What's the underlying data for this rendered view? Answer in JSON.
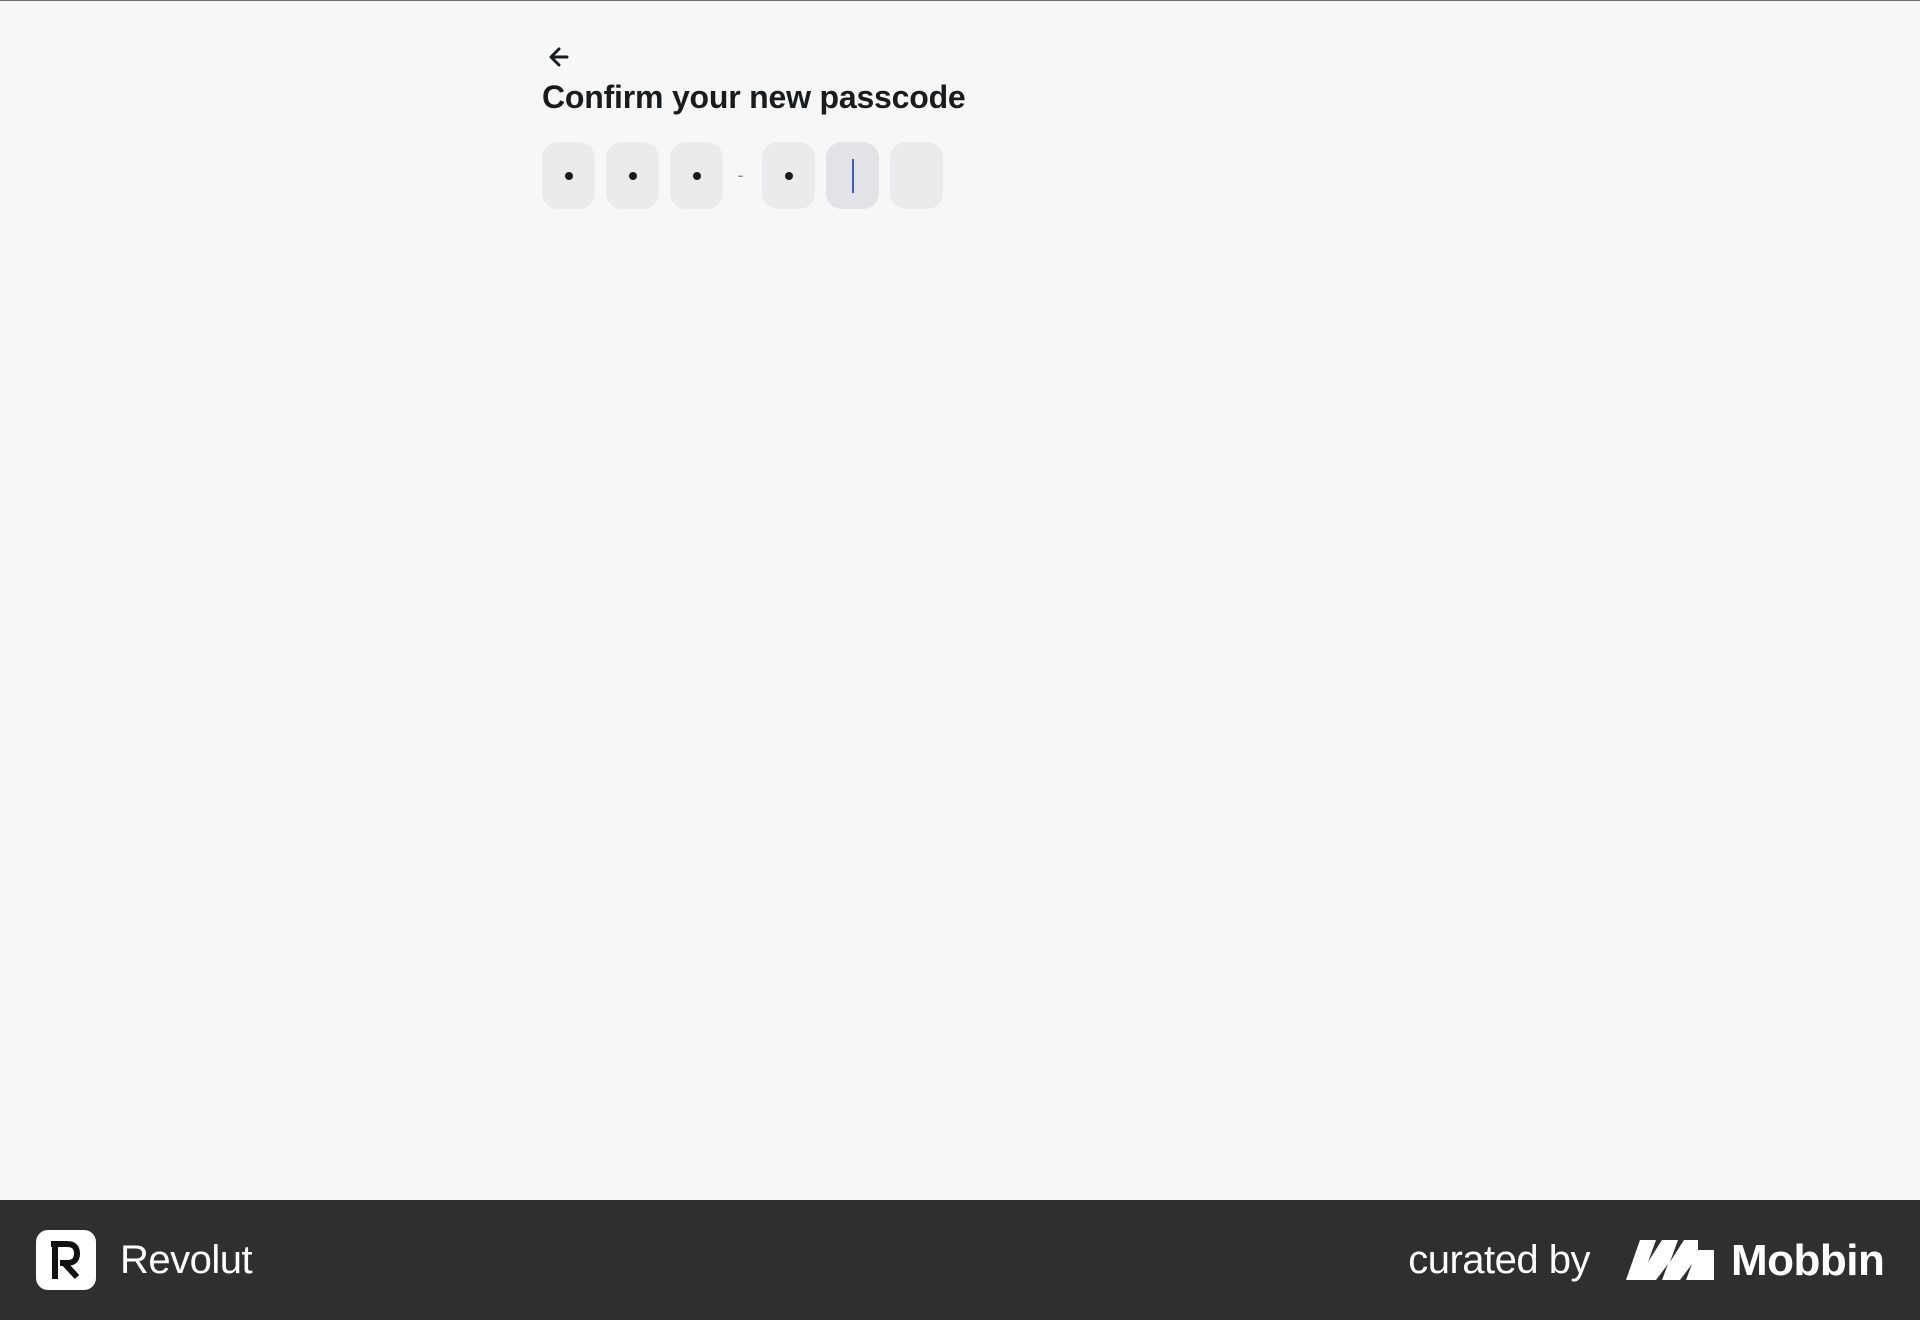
{
  "screen": {
    "title": "Confirm your new passcode",
    "back_icon": "back-arrow-icon"
  },
  "passcode": {
    "length": 6,
    "filled_count": 4,
    "active_index": 4,
    "separator": "-",
    "accent_color": "#3b5bdb",
    "slots": [
      {
        "state": "filled"
      },
      {
        "state": "filled"
      },
      {
        "state": "filled"
      },
      {
        "state": "filled"
      },
      {
        "state": "active"
      },
      {
        "state": "empty"
      }
    ]
  },
  "footer": {
    "brand_name": "Revolut",
    "brand_icon": "revolut-logo-icon",
    "curated_by": "curated by",
    "curator_name": "Mobbin",
    "curator_icon": "mobbin-logo-icon",
    "background_color": "#2f2f2f"
  }
}
